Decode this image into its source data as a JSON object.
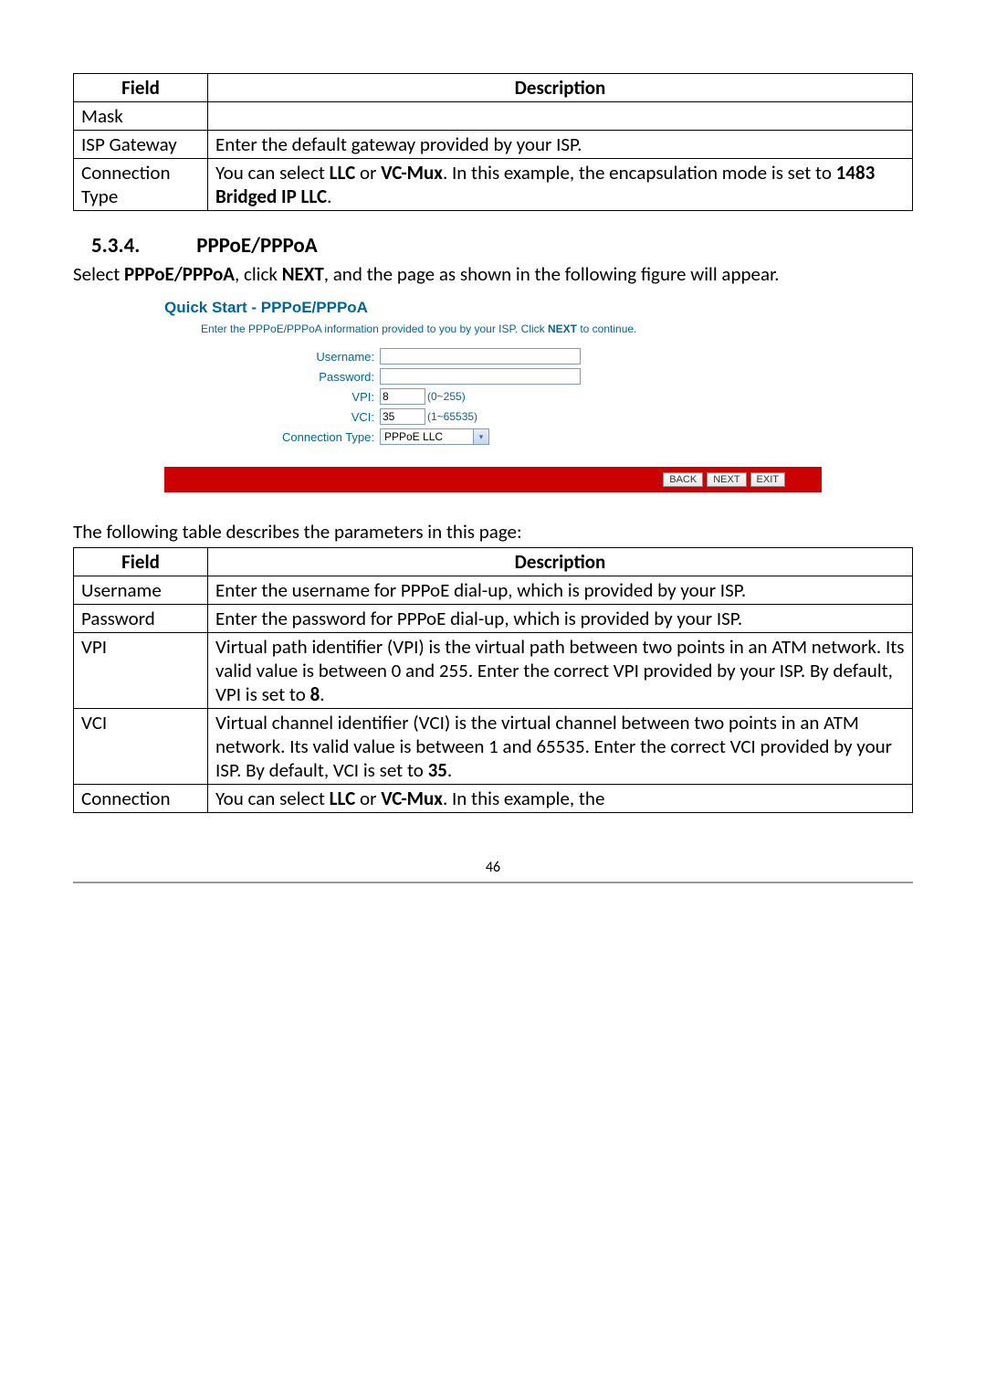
{
  "table1": {
    "header_field": "Field",
    "header_desc": "Description",
    "rows": [
      {
        "field": "Mask",
        "desc": ""
      },
      {
        "field": "ISP Gateway",
        "desc": "Enter the default gateway provided by your ISP."
      },
      {
        "field": "Connection Type",
        "desc_prefix": "You can select ",
        "b1": "LLC",
        "mid1": " or ",
        "b2": "VC-Mux",
        "mid2": ". In this example, the encapsulation mode is set to ",
        "b3": "1483 Bridged IP LLC",
        "suffix": "."
      }
    ]
  },
  "section": {
    "number": "5.3.4.",
    "title": "PPPoE/PPPoA",
    "intro_pre": "Select ",
    "intro_b1": "PPPoE/PPPoA",
    "intro_mid1": ", click ",
    "intro_b2": "NEXT",
    "intro_post": ", and the page as shown in the following figure will appear."
  },
  "figure": {
    "title": "Quick Start - PPPoE/PPPoA",
    "sub_pre": "Enter the PPPoE/PPPoA information provided to you by your ISP. Click ",
    "sub_b": "NEXT",
    "sub_post": " to continue.",
    "labels": {
      "username": "Username:",
      "password": "Password:",
      "vpi": "VPI:",
      "vci": "VCI:",
      "conn_type": "Connection Type:"
    },
    "values": {
      "username": "",
      "password": "",
      "vpi": "8",
      "vci": "35",
      "conn_type": "PPPoE LLC"
    },
    "hints": {
      "vpi": "(0~255)",
      "vci": "(1~65535)"
    },
    "buttons": {
      "back": "BACK",
      "next": "NEXT",
      "exit": "EXIT"
    }
  },
  "caption2": "The following table describes the parameters in this page:",
  "table2": {
    "header_field": "Field",
    "header_desc": "Description",
    "rows": {
      "username": {
        "field": "Username",
        "desc": "Enter the username for PPPoE dial-up, which is provided by your ISP."
      },
      "password": {
        "field": "Password",
        "desc": "Enter the password for PPPoE dial-up, which is provided by your ISP."
      },
      "vpi": {
        "field": "VPI",
        "desc_pre": "Virtual path identifier (VPI) is the virtual path between two points in an ATM network. Its valid value is between 0 and 255. Enter the correct VPI provided by your ISP. By default, VPI is set to ",
        "b": "8",
        "suffix": "."
      },
      "vci": {
        "field": "VCI",
        "desc_pre": "Virtual channel identifier (VCI) is the virtual channel between two points in an ATM network. Its valid value is between 1 and 65535. Enter the correct VCI provided by your ISP. By default, VCI is set to ",
        "b": "35",
        "suffix": "."
      },
      "conn": {
        "field": "Connection",
        "desc_pre": "You can select ",
        "b1": "LLC",
        "mid": " or ",
        "b2": "VC-Mux",
        "suffix": ". In this example, the"
      }
    }
  },
  "page_number": "46",
  "chart_data": null
}
